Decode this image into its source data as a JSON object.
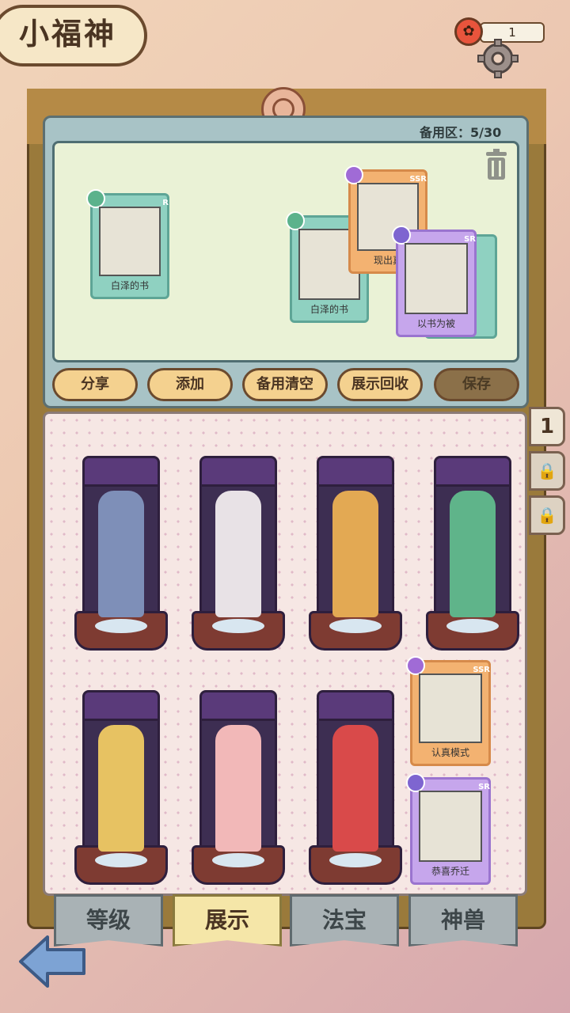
{
  "header": {
    "title": "小福神",
    "currency_value": "1",
    "currency_icon": "flower-icon",
    "settings_icon": "gear-icon"
  },
  "backup": {
    "count_label": "备用区：5/30",
    "cards": [
      {
        "label": "白泽的书",
        "rarity": "R"
      },
      {
        "label": "白泽的书",
        "rarity": "R"
      },
      {
        "label": "现出真",
        "rarity": "SSR"
      },
      {
        "label": "以书为被",
        "rarity": "SR"
      }
    ]
  },
  "buttons": {
    "share": "分享",
    "add": "添加",
    "clear_backup": "备用清空",
    "recall_display": "展示回收",
    "save": "保存"
  },
  "display": {
    "cards": [
      {
        "label": "认真模式",
        "rarity": "SSR"
      },
      {
        "label": "恭喜乔迁",
        "rarity": "SR"
      }
    ]
  },
  "side_tabs": {
    "page_1": "1"
  },
  "bottom_tabs": {
    "level": "等级",
    "display": "展示",
    "treasure": "法宝",
    "beast": "神兽"
  },
  "colors": {
    "accent": "#f4d18f",
    "panel": "#a8c3c6",
    "display_bg": "#f6e7e4"
  }
}
